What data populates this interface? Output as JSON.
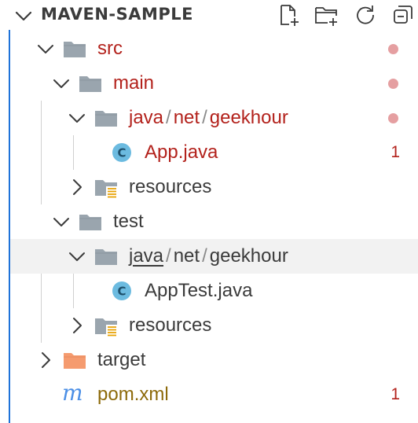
{
  "explorer": {
    "title": "MAVEN-SAMPLE",
    "actions": [
      "new-file-icon",
      "new-folder-icon",
      "refresh-icon",
      "collapse-all-icon"
    ]
  },
  "tree": {
    "src": "src",
    "main": "main",
    "main_pkg": [
      "java",
      "net",
      "geekhour"
    ],
    "sep": "/",
    "app_java": "App.java",
    "app_java_count": "1",
    "resources_main": "resources",
    "test": "test",
    "test_pkg": [
      "java",
      "net",
      "geekhour"
    ],
    "apptest_java": "AppTest.java",
    "resources_test": "resources",
    "target": "target",
    "pom": "pom.xml",
    "pom_count": "1",
    "java_badge": "C",
    "maven_badge": "m"
  },
  "colors": {
    "error": "#b3221c",
    "modified_dot": "#e59fa1",
    "folder": "#9aa5ae",
    "target_folder": "#f59b6f",
    "java_badge": "#6cbbe0",
    "active_border": "#1f73d9"
  }
}
